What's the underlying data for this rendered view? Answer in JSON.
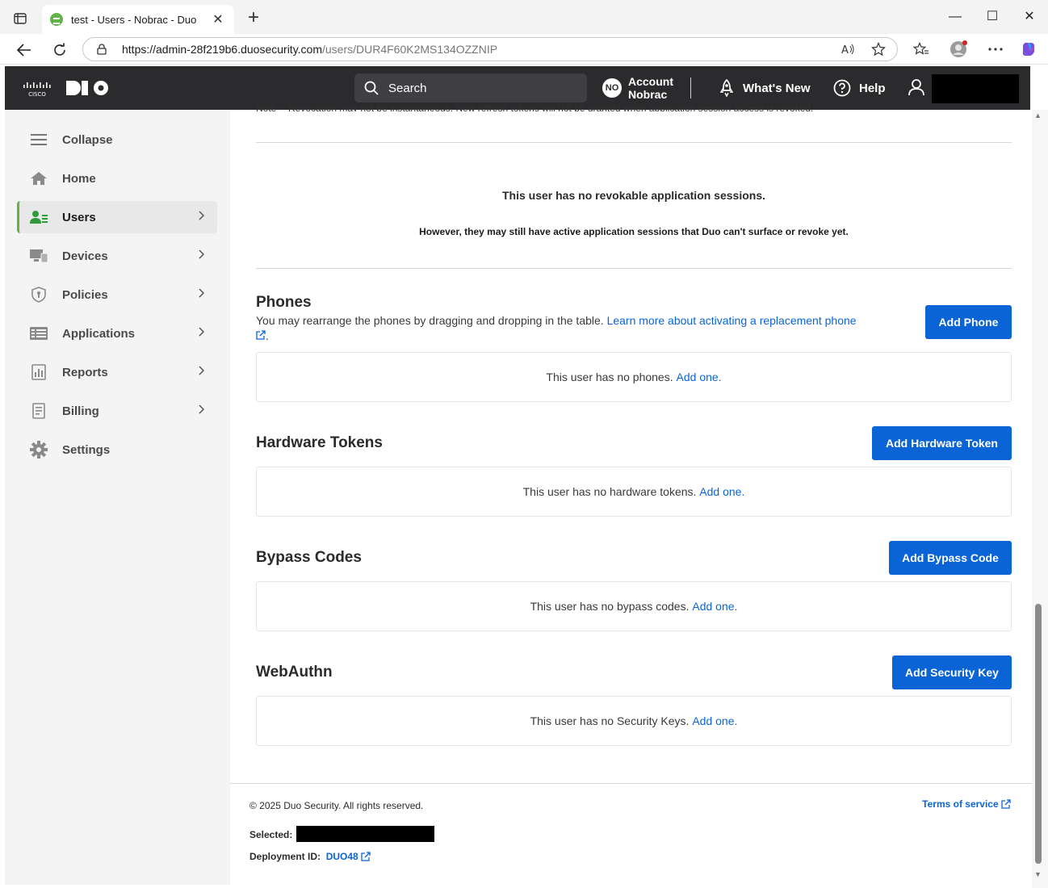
{
  "browser": {
    "tab_title": "test - Users - Nobrac - Duo",
    "tab_close": "✕",
    "new_tab": "+",
    "url_host": "https://admin-28f219b6.duosecurity.com",
    "url_path": "/users/DUR4F60K2MS134OZZNIP",
    "window_controls": {
      "minimize": "—",
      "maximize": "☐",
      "close": "✕"
    }
  },
  "header": {
    "search_placeholder": "Search",
    "account_initials": "NO",
    "account_line1": "Account",
    "account_line2": "Nobrac",
    "whats_new": "What's New",
    "help": "Help"
  },
  "sidebar": {
    "items": [
      {
        "label": "Collapse",
        "icon": "hamburger-icon"
      },
      {
        "label": "Home",
        "icon": "home-icon"
      },
      {
        "label": "Users",
        "icon": "users-icon",
        "active": true
      },
      {
        "label": "Devices",
        "icon": "devices-icon"
      },
      {
        "label": "Policies",
        "icon": "shield-icon"
      },
      {
        "label": "Applications",
        "icon": "applications-icon"
      },
      {
        "label": "Reports",
        "icon": "reports-icon"
      },
      {
        "label": "Billing",
        "icon": "billing-icon"
      },
      {
        "label": "Settings",
        "icon": "gear-icon"
      }
    ]
  },
  "sessions": {
    "cut_note": "Note -- Revocation may not be instantaneous. New refresh tokens will not be granted when application session access is revoked.",
    "no_sessions": "This user has no revokable application sessions.",
    "however": "However, they may still have active application sessions that Duo can't surface or revoke yet."
  },
  "phones": {
    "title": "Phones",
    "desc": "You may rearrange the phones by dragging and dropping in the table.",
    "learn_link": "Learn more about activating a replacement phone",
    "period": ".",
    "button": "Add Phone",
    "empty": "This user has no phones.",
    "add_one": "Add one."
  },
  "hardware_tokens": {
    "title": "Hardware Tokens",
    "button": "Add Hardware Token",
    "empty": "This user has no hardware tokens.",
    "add_one": "Add one."
  },
  "bypass_codes": {
    "title": "Bypass Codes",
    "button": "Add Bypass Code",
    "empty": "This user has no bypass codes.",
    "add_one": "Add one."
  },
  "webauthn": {
    "title": "WebAuthn",
    "button": "Add Security Key",
    "empty": "This user has no Security Keys.",
    "add_one": "Add one."
  },
  "footer": {
    "copyright": "© 2025 Duo Security. All rights reserved.",
    "terms": "Terms of service",
    "selected_label": "Selected:",
    "deployment_label": "Deployment ID:",
    "deployment_id": "DUO48"
  },
  "colors": {
    "accent": "#0a64d6",
    "header_bg": "#2b2b2e",
    "active_green": "#63b346",
    "sidebar_bg": "#f4f4f4"
  }
}
